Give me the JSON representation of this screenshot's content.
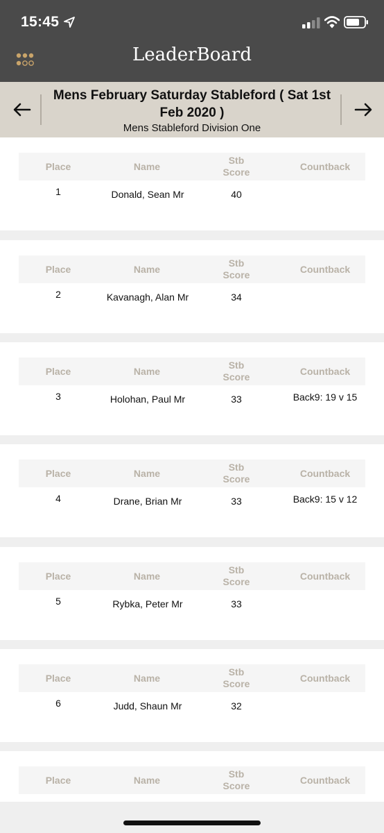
{
  "status_bar": {
    "time": "15:45"
  },
  "app": {
    "title": "LeaderBoard"
  },
  "competition": {
    "title": "Mens February Saturday Stableford ( Sat 1st Feb 2020 )",
    "division": "Mens Stableford Division One"
  },
  "table_headers": {
    "place": "Place",
    "name": "Name",
    "score": "Stb Score",
    "countback": "Countback"
  },
  "results": [
    {
      "place": "1",
      "name": "Donald, Sean Mr",
      "score": "40",
      "countback": ""
    },
    {
      "place": "2",
      "name": "Kavanagh, Alan Mr",
      "score": "34",
      "countback": ""
    },
    {
      "place": "3",
      "name": "Holohan, Paul Mr",
      "score": "33",
      "countback": "Back9: 19 v 15"
    },
    {
      "place": "4",
      "name": "Drane, Brian Mr",
      "score": "33",
      "countback": "Back9: 15 v 12"
    },
    {
      "place": "5",
      "name": "Rybka, Peter Mr",
      "score": "33",
      "countback": ""
    },
    {
      "place": "6",
      "name": "Judd, Shaun Mr",
      "score": "32",
      "countback": ""
    },
    {
      "place": "",
      "name": "",
      "score": "",
      "countback": ""
    }
  ],
  "colors": {
    "topbar": "#4a4a4a",
    "header_band": "#d9d4cb",
    "accent_gold": "#c9a46a",
    "column_header_text": "#b9b2a7"
  }
}
